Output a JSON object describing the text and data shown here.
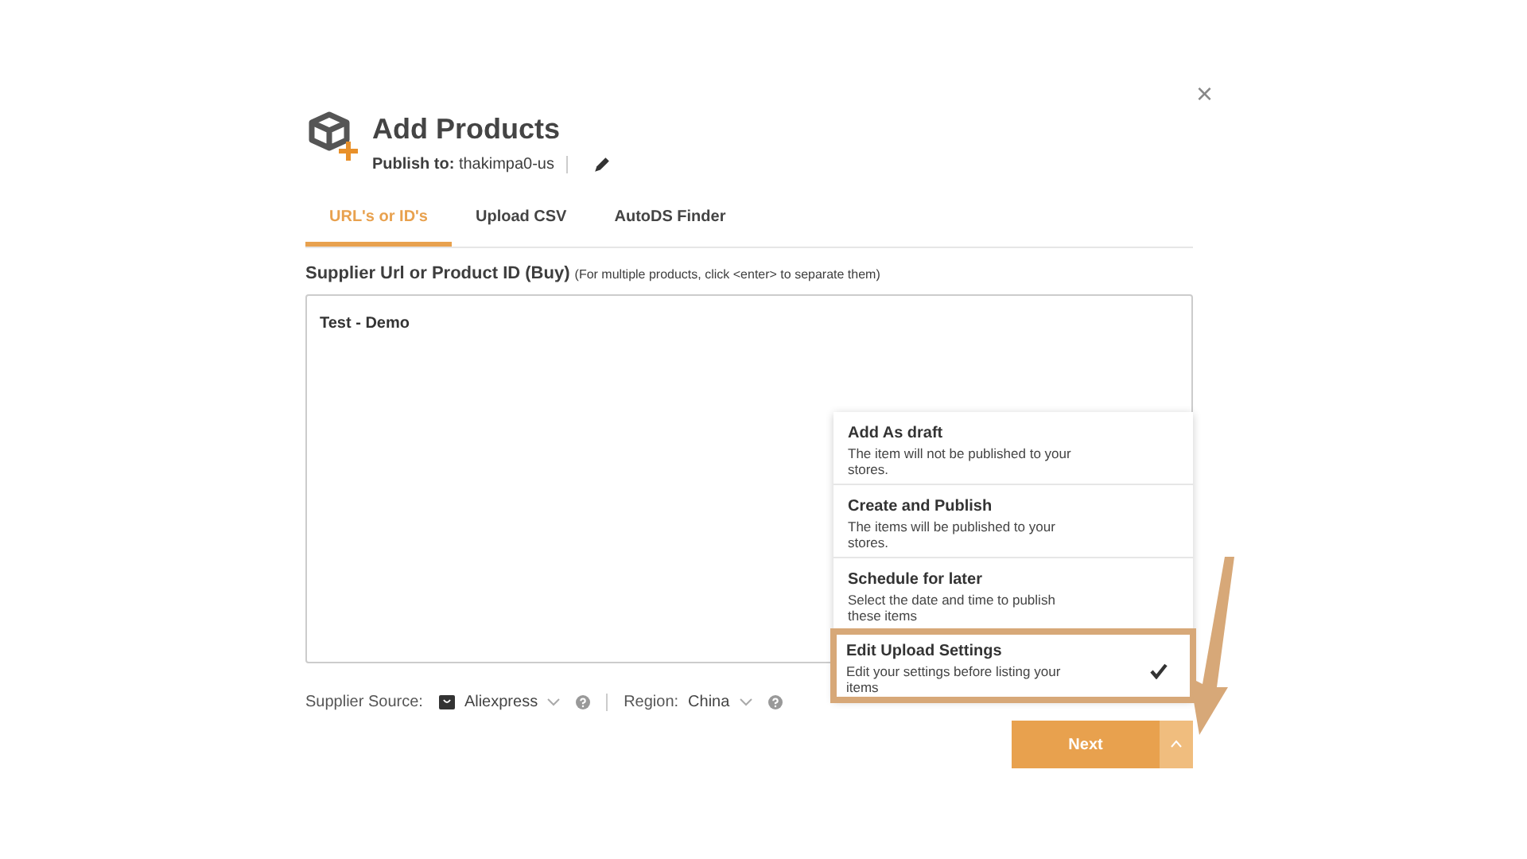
{
  "dialog": {
    "title": "Add Products",
    "publish_label": "Publish to:",
    "publish_value": "thakimpa0-us",
    "close": "×"
  },
  "tabs": [
    {
      "label": "URL's or ID's",
      "selected": true
    },
    {
      "label": "Upload CSV",
      "selected": false
    },
    {
      "label": "AutoDS Finder",
      "selected": false
    }
  ],
  "field": {
    "label": "Supplier Url or Product ID (Buy)",
    "hint": "(For multiple products, click <enter> to separate them)",
    "value": "Test - Demo"
  },
  "footer": {
    "source_label": "Supplier Source:",
    "source_value": "Aliexpress",
    "region_label": "Region:",
    "region_value": "China"
  },
  "menu": [
    {
      "title": "Add As draft",
      "description": "The item will not be published to your stores.",
      "selected": false
    },
    {
      "title": "Create and Publish",
      "description": "The items will be published to your stores.",
      "selected": false
    },
    {
      "title": "Schedule for later",
      "description": "Select the date and time to publish these items",
      "selected": false
    },
    {
      "title": "Edit Upload Settings",
      "description": "Edit your settings before listing your items",
      "selected": true
    }
  ],
  "next_button": {
    "label": "Next"
  }
}
